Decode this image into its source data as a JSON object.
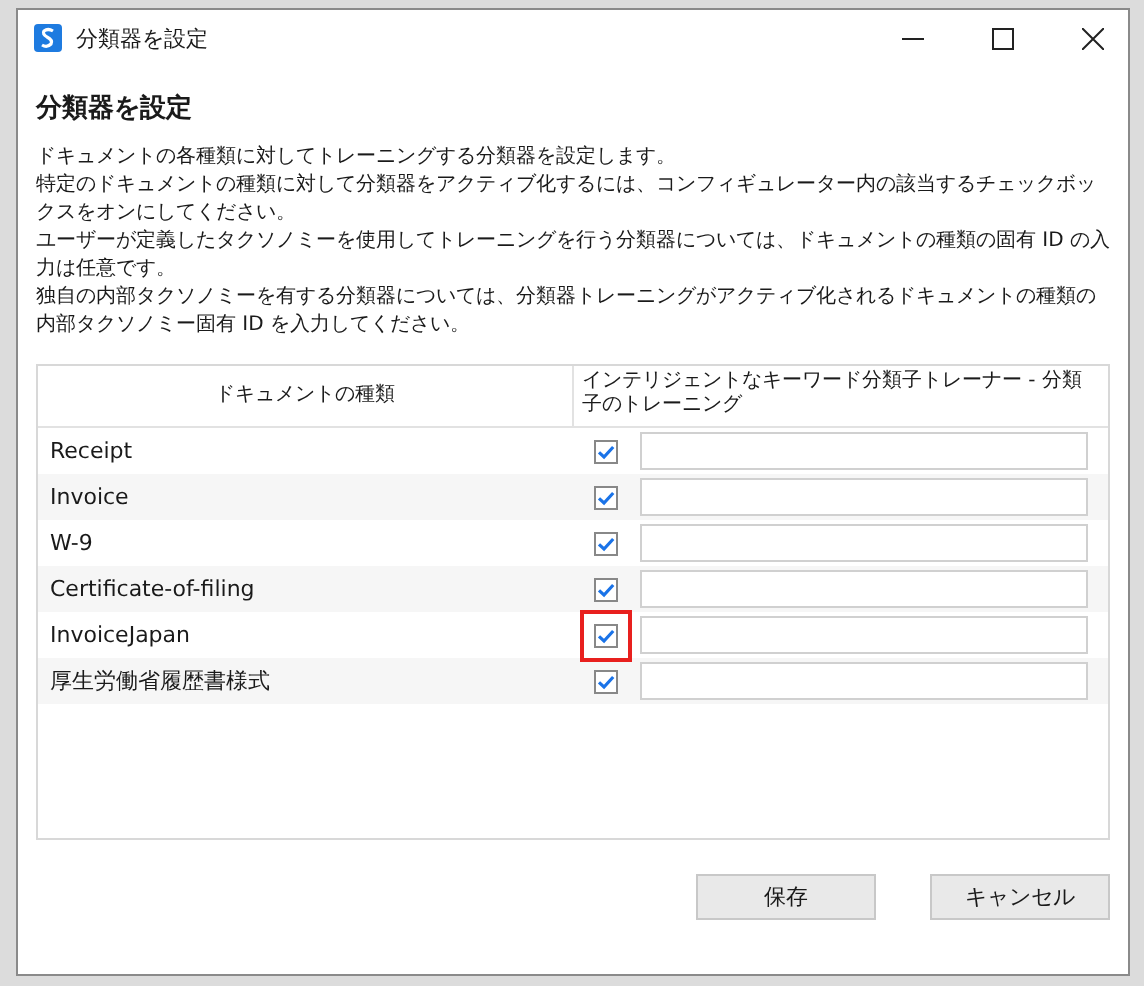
{
  "window": {
    "title": "分類器を設定"
  },
  "heading": "分類器を設定",
  "description": [
    "ドキュメントの各種類に対してトレーニングする分類器を設定します。",
    "特定のドキュメントの種類に対して分類器をアクティブ化するには、コンフィギュレーター内の該当するチェックボックスをオンにしてください。",
    "ユーザーが定義したタクソノミーを使用してトレーニングを行う分類器については、ドキュメントの種類の固有 ID の入力は任意です。",
    "独自の内部タクソノミーを有する分類器については、分類器トレーニングがアクティブ化されるドキュメントの種類の内部タクソノミー固有 ID を入力してください。"
  ],
  "table": {
    "columns": [
      "ドキュメントの種類",
      "インテリジェントなキーワード分類子トレーナー - 分類子のトレーニング"
    ],
    "rows": [
      {
        "name": "Receipt",
        "checked": true,
        "highlighted": false
      },
      {
        "name": "Invoice",
        "checked": true,
        "highlighted": false
      },
      {
        "name": "W-9",
        "checked": true,
        "highlighted": false
      },
      {
        "name": "Certificate-of-filing",
        "checked": true,
        "highlighted": false
      },
      {
        "name": "InvoiceJapan",
        "checked": true,
        "highlighted": true
      },
      {
        "name": "厚生労働省履歴書様式",
        "checked": true,
        "highlighted": false
      }
    ]
  },
  "buttons": [
    "保存",
    "キャンセル"
  ]
}
